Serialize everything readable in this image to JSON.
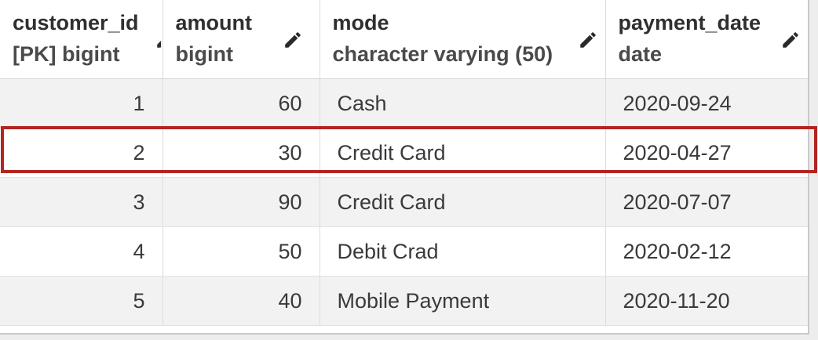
{
  "columns": [
    {
      "name": "customer_id",
      "type": "[PK] bigint",
      "icon": "pencil-icon"
    },
    {
      "name": "amount",
      "type": "bigint",
      "icon": "pencil-icon"
    },
    {
      "name": "mode",
      "type": "character varying (50)",
      "icon": "pencil-icon"
    },
    {
      "name": "payment_date",
      "type": "date",
      "icon": "pencil-icon"
    }
  ],
  "rows": [
    {
      "customer_id": "1",
      "amount": "60",
      "mode": "Cash",
      "payment_date": "2020-09-24"
    },
    {
      "customer_id": "2",
      "amount": "30",
      "mode": "Credit Card",
      "payment_date": "2020-04-27"
    },
    {
      "customer_id": "3",
      "amount": "90",
      "mode": "Credit Card",
      "payment_date": "2020-07-07"
    },
    {
      "customer_id": "4",
      "amount": "50",
      "mode": "Debit Crad",
      "payment_date": "2020-02-12"
    },
    {
      "customer_id": "5",
      "amount": "40",
      "mode": "Mobile Payment",
      "payment_date": "2020-11-20"
    }
  ],
  "highlighted_row": 2,
  "colors": {
    "highlight_border": "#b5241f",
    "row_shade": "#f2f2f2",
    "text": "#3a3a3a"
  }
}
